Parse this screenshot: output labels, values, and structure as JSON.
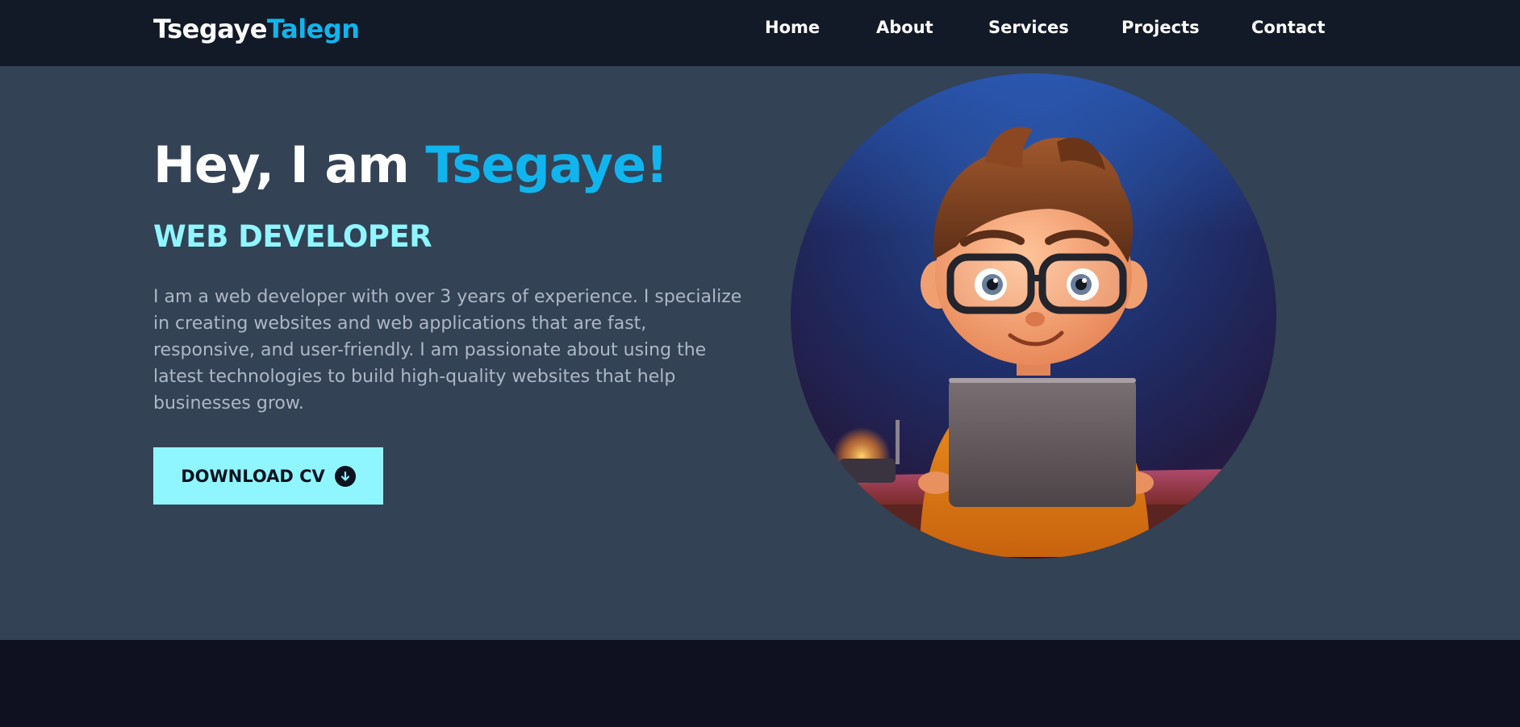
{
  "logo": {
    "first": "Tsegaye",
    "last": "Talegn"
  },
  "nav": {
    "items": [
      {
        "label": "Home"
      },
      {
        "label": "About"
      },
      {
        "label": "Services"
      },
      {
        "label": "Projects"
      },
      {
        "label": "Contact"
      }
    ]
  },
  "hero": {
    "greeting": "Hey, I am ",
    "name": "Tsegaye!",
    "role": "WEB DEVELOPER",
    "bio": "I am a web developer with over 3 years of experience. I specialize in creating websites and web applications that are fast, responsive, and user-friendly. I am passionate about using the latest technologies to build high-quality websites that help businesses grow.",
    "cv_button_label": "DOWNLOAD CV",
    "cv_icon": "arrow-down-circle-icon",
    "avatar": "developer-avatar-illustration"
  },
  "colors": {
    "nav_bg": "#131a27",
    "hero_bg": "#334255",
    "accent_blue": "#10b5ee",
    "accent_cyan": "#8ff6ff",
    "footer_bg": "#0f1020"
  }
}
